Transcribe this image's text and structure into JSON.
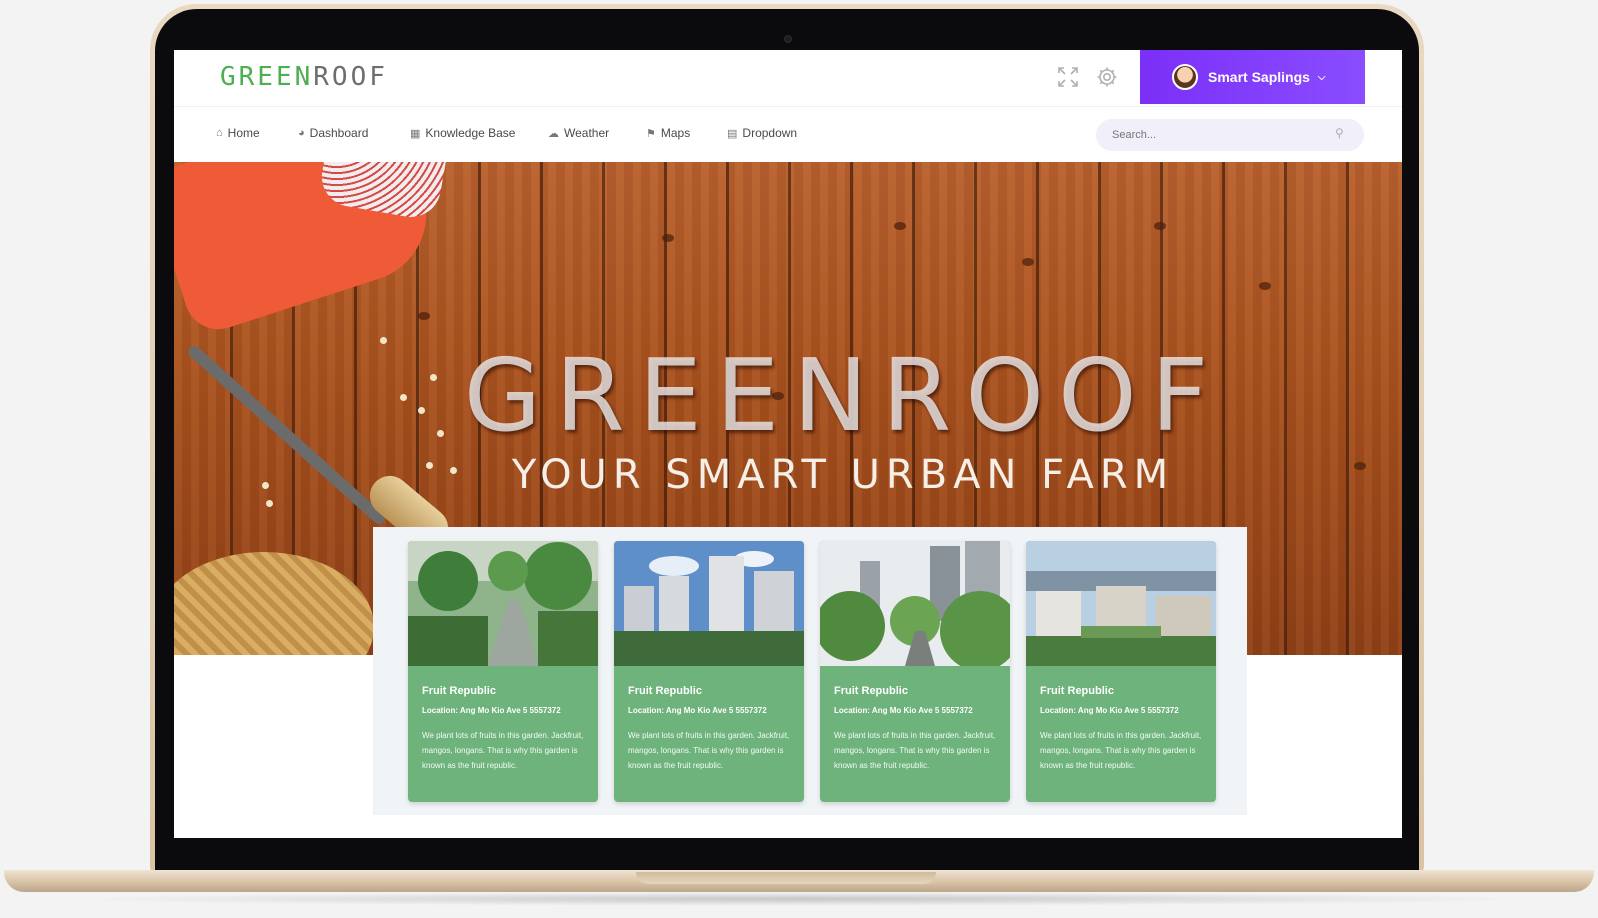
{
  "header": {
    "logo_green": "GREEN",
    "logo_rest": "ROOF",
    "user_name": "Smart Saplings"
  },
  "icons": {
    "fullscreen": "fullscreen-icon",
    "settings": "gear-icon",
    "search": "search-icon"
  },
  "nav": {
    "items": [
      {
        "label": "Home",
        "icon": "home-icon"
      },
      {
        "label": "Dashboard",
        "icon": "dashboard-icon"
      },
      {
        "label": "Knowledge Base",
        "icon": "database-icon"
      },
      {
        "label": "Weather",
        "icon": "cloud-icon"
      },
      {
        "label": "Maps",
        "icon": "map-icon"
      },
      {
        "label": "Dropdown",
        "icon": "table-icon"
      }
    ],
    "search_placeholder": "Search..."
  },
  "hero": {
    "title": "GREENROOF",
    "subtitle": "YOUR SMART URBAN FARM"
  },
  "cards": [
    {
      "title": "Fruit Republic",
      "location": "Location: Ang Mo Kio Ave 5 5557372",
      "description": "We plant lots of fruits in this garden. Jackfruit, mangos, longans. That is why this garden is known as the fruit republic."
    },
    {
      "title": "Fruit Republic",
      "location": "Location: Ang Mo Kio Ave 5 5557372",
      "description": "We plant lots of fruits in this garden. Jackfruit, mangos, longans. That is why this garden is known as the fruit republic."
    },
    {
      "title": "Fruit Republic",
      "location": "Location: Ang Mo Kio Ave 5 5557372",
      "description": "We plant lots of fruits in this garden. Jackfruit, mangos, longans. That is why this garden is known as the fruit republic."
    },
    {
      "title": "Fruit Republic",
      "location": "Location: Ang Mo Kio Ave 5 5557372",
      "description": "We plant lots of fruits in this garden. Jackfruit, mangos, longans. That is why this garden is known as the fruit republic."
    }
  ],
  "colors": {
    "accent_purple": "#7b2ff7",
    "logo_green": "#4caf50",
    "card_green": "#6db37b"
  }
}
